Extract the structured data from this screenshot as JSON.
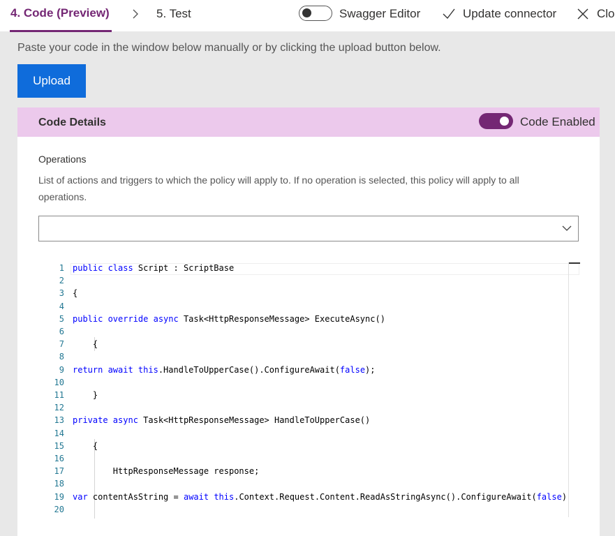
{
  "header": {
    "tab_code": "4. Code (Preview)",
    "tab_test": "5. Test",
    "swagger_label": "Swagger Editor",
    "update_label": "Update connector",
    "close_label": "Clo"
  },
  "main": {
    "instruction": "Paste your code in the window below manually or by clicking the upload button below.",
    "upload_label": "Upload"
  },
  "card": {
    "title": "Code Details",
    "enabled_label": "Code Enabled",
    "operations_label": "Operations",
    "operations_desc": "List of actions and triggers to which the policy will apply to. If no operation is selected, this policy will apply to all operations.",
    "operations_value": ""
  },
  "colors": {
    "accent": "#742774",
    "header_band": "#ecc9ec",
    "upload": "#0f6cdb",
    "keyword": "#0000ff",
    "line_number": "#237893"
  },
  "code": {
    "lines": [
      {
        "n": "1",
        "segs": [
          [
            "public class",
            "kw"
          ],
          [
            " Script : ScriptBase",
            ""
          ]
        ]
      },
      {
        "n": "2",
        "segs": []
      },
      {
        "n": "3",
        "segs": [
          [
            "{",
            ""
          ]
        ]
      },
      {
        "n": "4",
        "segs": []
      },
      {
        "n": "5",
        "segs": [
          [
            "public override async",
            "kw"
          ],
          [
            " Task<HttpResponseMessage> ExecuteAsync()",
            ""
          ]
        ]
      },
      {
        "n": "6",
        "segs": []
      },
      {
        "n": "7",
        "segs": [
          [
            "    {",
            ""
          ]
        ]
      },
      {
        "n": "8",
        "segs": []
      },
      {
        "n": "9",
        "segs": [
          [
            "return await this",
            "kw"
          ],
          [
            ".HandleToUpperCase().ConfigureAwait(",
            ""
          ],
          [
            "false",
            "kw"
          ],
          [
            ");",
            ""
          ]
        ]
      },
      {
        "n": "10",
        "segs": []
      },
      {
        "n": "11",
        "segs": [
          [
            "    }",
            ""
          ]
        ]
      },
      {
        "n": "12",
        "segs": []
      },
      {
        "n": "13",
        "segs": [
          [
            "private async",
            "kw"
          ],
          [
            " Task<HttpResponseMessage> HandleToUpperCase()",
            ""
          ]
        ]
      },
      {
        "n": "14",
        "segs": []
      },
      {
        "n": "15",
        "segs": [
          [
            "    {",
            ""
          ]
        ]
      },
      {
        "n": "16",
        "segs": []
      },
      {
        "n": "17",
        "segs": [
          [
            "        HttpResponseMessage response;",
            ""
          ]
        ]
      },
      {
        "n": "18",
        "segs": []
      },
      {
        "n": "19",
        "segs": [
          [
            "var",
            "kw"
          ],
          [
            " contentAsString = ",
            ""
          ],
          [
            "await this",
            "kw"
          ],
          [
            ".Context.Request.Content.ReadAsStringAsync().ConfigureAwait(",
            ""
          ],
          [
            "false",
            "kw"
          ],
          [
            ")",
            ""
          ]
        ]
      },
      {
        "n": "20",
        "segs": []
      }
    ]
  }
}
